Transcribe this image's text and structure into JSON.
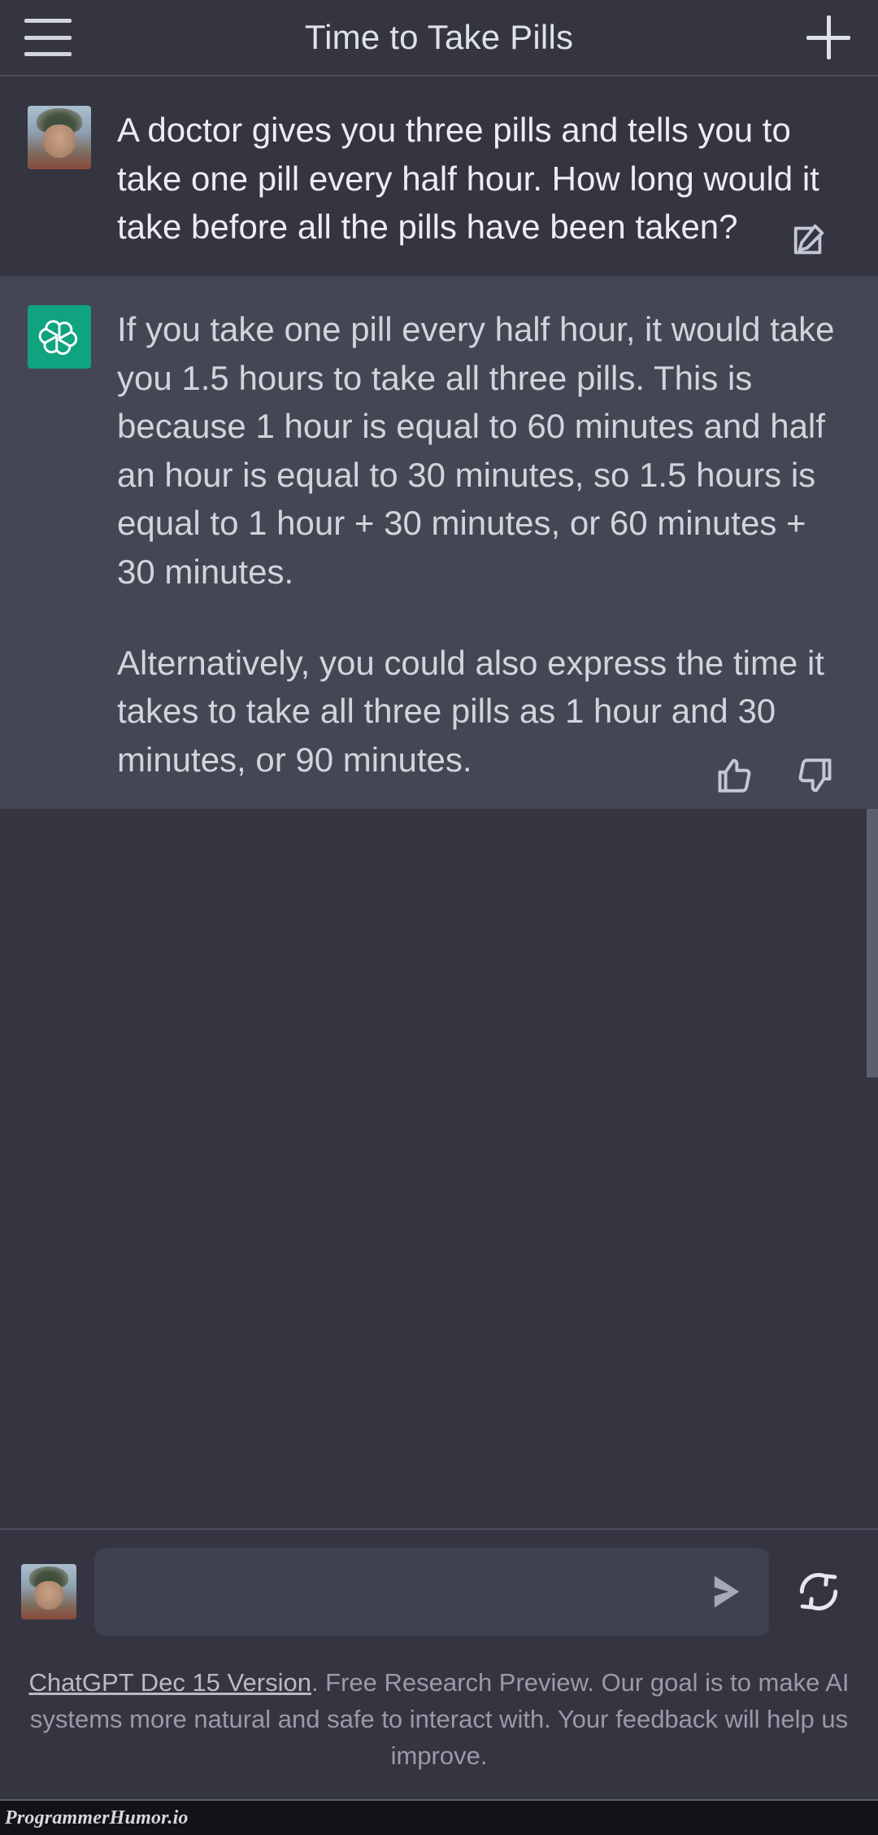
{
  "header": {
    "title": "Time to Take Pills",
    "menu_icon": "hamburger-menu-icon",
    "new_chat_icon": "plus-icon"
  },
  "conversation": [
    {
      "role": "user",
      "avatar": "user-avatar-photo",
      "paragraphs": [
        "A doctor gives you three pills and tells you to take one pill every half hour. How long would it take before all the pills have been taken?"
      ],
      "action_icon": "edit-message-icon"
    },
    {
      "role": "assistant",
      "avatar": "chatgpt-logo-icon",
      "paragraphs": [
        "If you take one pill every half hour, it would take you 1.5 hours to take all three pills. This is because 1 hour is equal to 60 minutes and half an hour is equal to 30 minutes, so 1.5 hours is equal to 1 hour + 30 minutes, or 60 minutes + 30 minutes.",
        "Alternatively, you could also express the time it takes to take all three pills as 1 hour and 30 minutes, or 90 minutes."
      ],
      "feedback": {
        "thumbs_up_icon": "thumbs-up-icon",
        "thumbs_down_icon": "thumbs-down-icon"
      }
    }
  ],
  "composer": {
    "avatar": "user-avatar-photo",
    "input_value": "",
    "input_placeholder": "",
    "send_icon": "send-arrow-icon",
    "regenerate_icon": "regenerate-refresh-icon"
  },
  "footer": {
    "version_link": "ChatGPT Dec 15 Version",
    "disclaimer": ". Free Research Preview. Our goal is to make AI systems more natural and safe to interact with. Your feedback will help us improve."
  },
  "watermark": {
    "text": "ProgrammerHumor.io"
  },
  "colors": {
    "header_bg": "#353541",
    "user_bg": "#353541",
    "assistant_bg": "#444654",
    "brand_green": "#10a37f",
    "text_primary": "#ececf1",
    "text_secondary": "#d1d5db",
    "text_muted": "#9a9aa8"
  }
}
